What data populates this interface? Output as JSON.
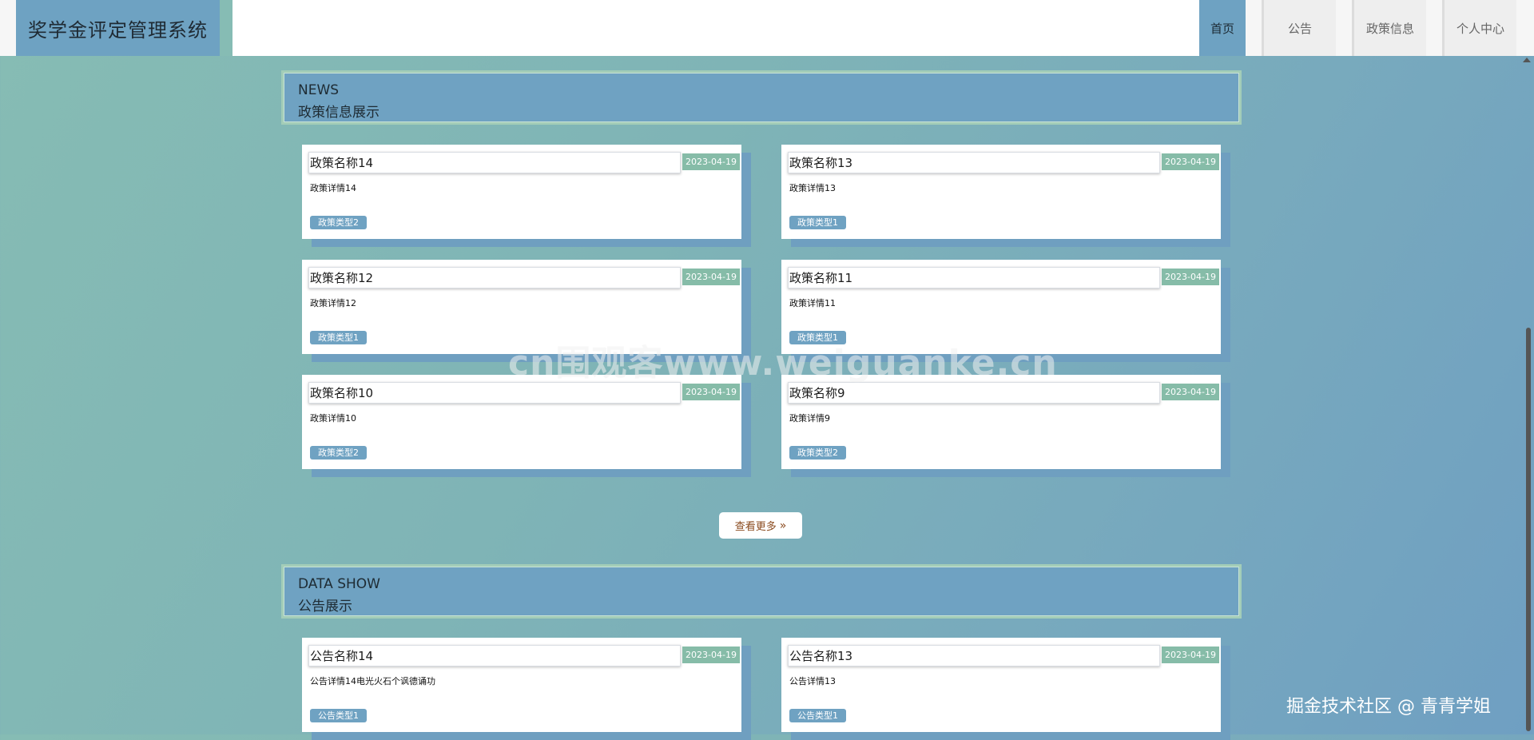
{
  "header": {
    "brand": "奖学金评定管理系统",
    "nav": [
      {
        "label": "首页",
        "active": true
      },
      {
        "label": "公告",
        "active": false
      },
      {
        "label": "政策信息",
        "active": false
      },
      {
        "label": "个人中心",
        "active": false
      }
    ]
  },
  "news_section": {
    "en": "NEWS",
    "cn": "政策信息展示",
    "cards": [
      {
        "title": "政策名称14",
        "date": "2023-04-19",
        "detail": "政策详情14",
        "tag": "政策类型2"
      },
      {
        "title": "政策名称13",
        "date": "2023-04-19",
        "detail": "政策详情13",
        "tag": "政策类型1"
      },
      {
        "title": "政策名称12",
        "date": "2023-04-19",
        "detail": "政策详情12",
        "tag": "政策类型1"
      },
      {
        "title": "政策名称11",
        "date": "2023-04-19",
        "detail": "政策详情11",
        "tag": "政策类型1"
      },
      {
        "title": "政策名称10",
        "date": "2023-04-19",
        "detail": "政策详情10",
        "tag": "政策类型2"
      },
      {
        "title": "政策名称9",
        "date": "2023-04-19",
        "detail": "政策详情9",
        "tag": "政策类型2"
      }
    ],
    "more_label": "查看更多"
  },
  "notice_section": {
    "en": "DATA SHOW",
    "cn": "公告展示",
    "cards": [
      {
        "title": "公告名称14",
        "date": "2023-04-19",
        "detail": "公告详情14电光火石个讽德诵功",
        "tag": "公告类型1"
      },
      {
        "title": "公告名称13",
        "date": "2023-04-19",
        "detail": "公告详情13",
        "tag": "公告类型1"
      }
    ]
  },
  "watermark": "cn围观客www.weiguanke.cn",
  "footer_mark": "掘金技术社区 @ 青青学姐",
  "colors": {
    "accent": "#6fa2c2",
    "date_badge": "#86bca8",
    "more_text": "#8a4a1e"
  }
}
